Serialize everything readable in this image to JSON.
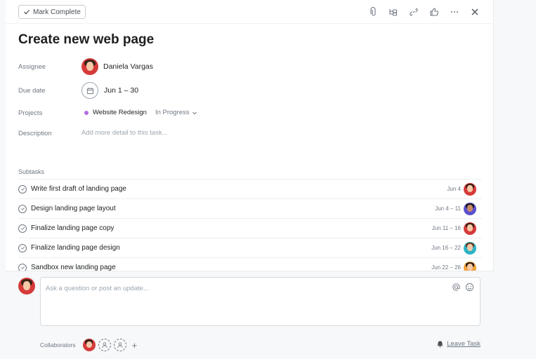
{
  "toolbar": {
    "mark_complete_label": "Mark Complete",
    "icons": [
      "attachment-icon",
      "subtask-icon",
      "link-icon",
      "like-icon",
      "more-icon",
      "close-icon"
    ]
  },
  "task": {
    "title": "Create new web page",
    "assignee_label": "Assignee",
    "assignee_name": "Daniela Vargas",
    "due_label": "Due date",
    "due_value": "Jun 1 – 30",
    "projects_label": "Projects",
    "project_name": "Website Redesign",
    "project_color": "#b56ce0",
    "project_status": "In Progress",
    "description_label": "Description",
    "description_placeholder": "Add more detail to this task..."
  },
  "subtasks": {
    "label": "Subtasks",
    "items": [
      {
        "name": "Write first draft of landing page",
        "date": "Jun 4",
        "avatar_color": "#d63a3a"
      },
      {
        "name": "Design landing page layout",
        "date": "Jun 4 – 11",
        "avatar_color": "#5a4fcf"
      },
      {
        "name": "Finalize landing page copy",
        "date": "Jun 11 – 16",
        "avatar_color": "#d63a3a"
      },
      {
        "name": "Finalize landing page design",
        "date": "Jun 16 – 22",
        "avatar_color": "#2bb3c6"
      },
      {
        "name": "Sandbox new landing page",
        "date": "Jun 22 – 26",
        "avatar_color": "#f2a23a"
      }
    ]
  },
  "comment": {
    "placeholder": "Ask a question or post an update..."
  },
  "collaborators": {
    "label": "Collaborators",
    "add_symbol": "+"
  },
  "leave_task_label": "Leave Task"
}
